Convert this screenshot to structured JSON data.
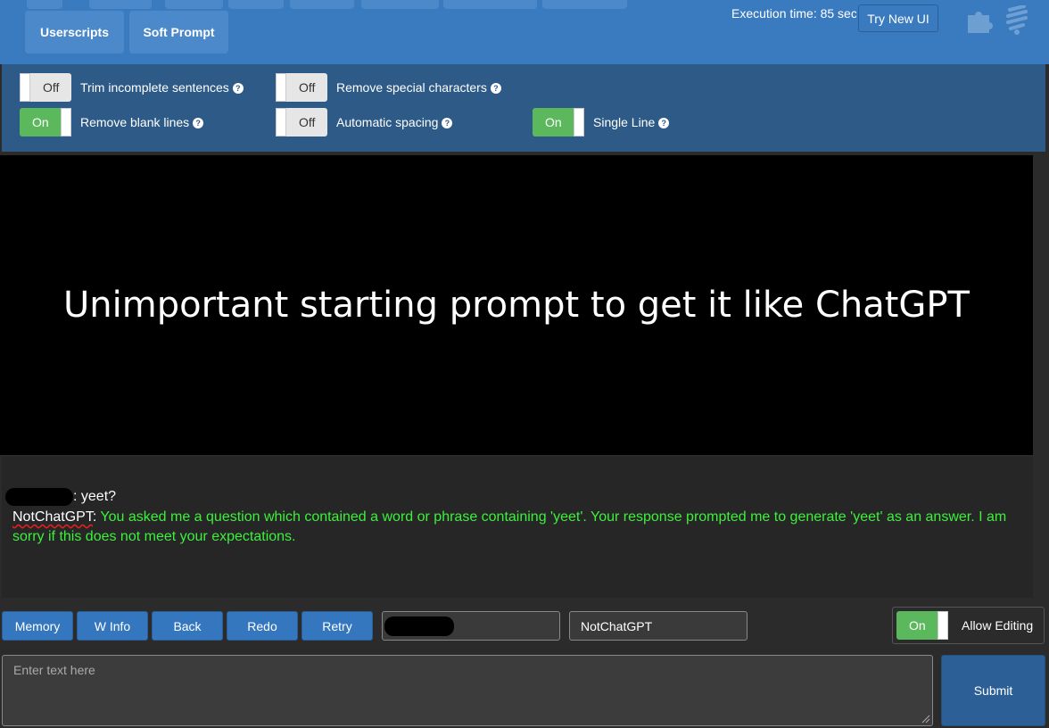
{
  "topbar": {
    "tabs": [
      {
        "label": "Userscripts"
      },
      {
        "label": "Soft Prompt"
      }
    ],
    "execution_time": "Execution time: 85 sec",
    "try_new_ui": "Try New UI",
    "icons": [
      "puzzle-icon",
      "lightbulb-icon"
    ]
  },
  "settings": {
    "trim_incomplete": {
      "state": "Off",
      "label": "Trim incomplete sentences"
    },
    "remove_special": {
      "state": "Off",
      "label": "Remove special characters"
    },
    "remove_blank": {
      "state": "On",
      "label": "Remove blank lines"
    },
    "auto_spacing": {
      "state": "Off",
      "label": "Automatic spacing"
    },
    "single_line": {
      "state": "On",
      "label": "Single Line"
    },
    "help_glyph": "?"
  },
  "story": {
    "image_text": "Unimportant starting prompt to get it like ChatGPT",
    "user_message": ": yeet?",
    "bot_name": "NotChatGPT",
    "bot_sep": ":",
    "bot_message": " You asked me a question which contained a word or phrase containing 'yeet'. Your response prompted me to generate 'yeet' as an answer. I am sorry if this does not meet your expectations."
  },
  "controls": {
    "memory": "Memory",
    "winfo": "W Info",
    "back": "Back",
    "redo": "Redo",
    "retry": "Retry",
    "bot_name_value": "NotChatGPT",
    "allow_editing_state": "On",
    "allow_editing_label": "Allow Editing",
    "input_placeholder": "Enter text here",
    "submit": "Submit"
  },
  "colors": {
    "navbar": "#3a7bc0",
    "settings_bg": "#2d5a86",
    "toggle_on": "#5cb85c",
    "bot_text": "#3cf03c",
    "button": "#3577bf"
  }
}
